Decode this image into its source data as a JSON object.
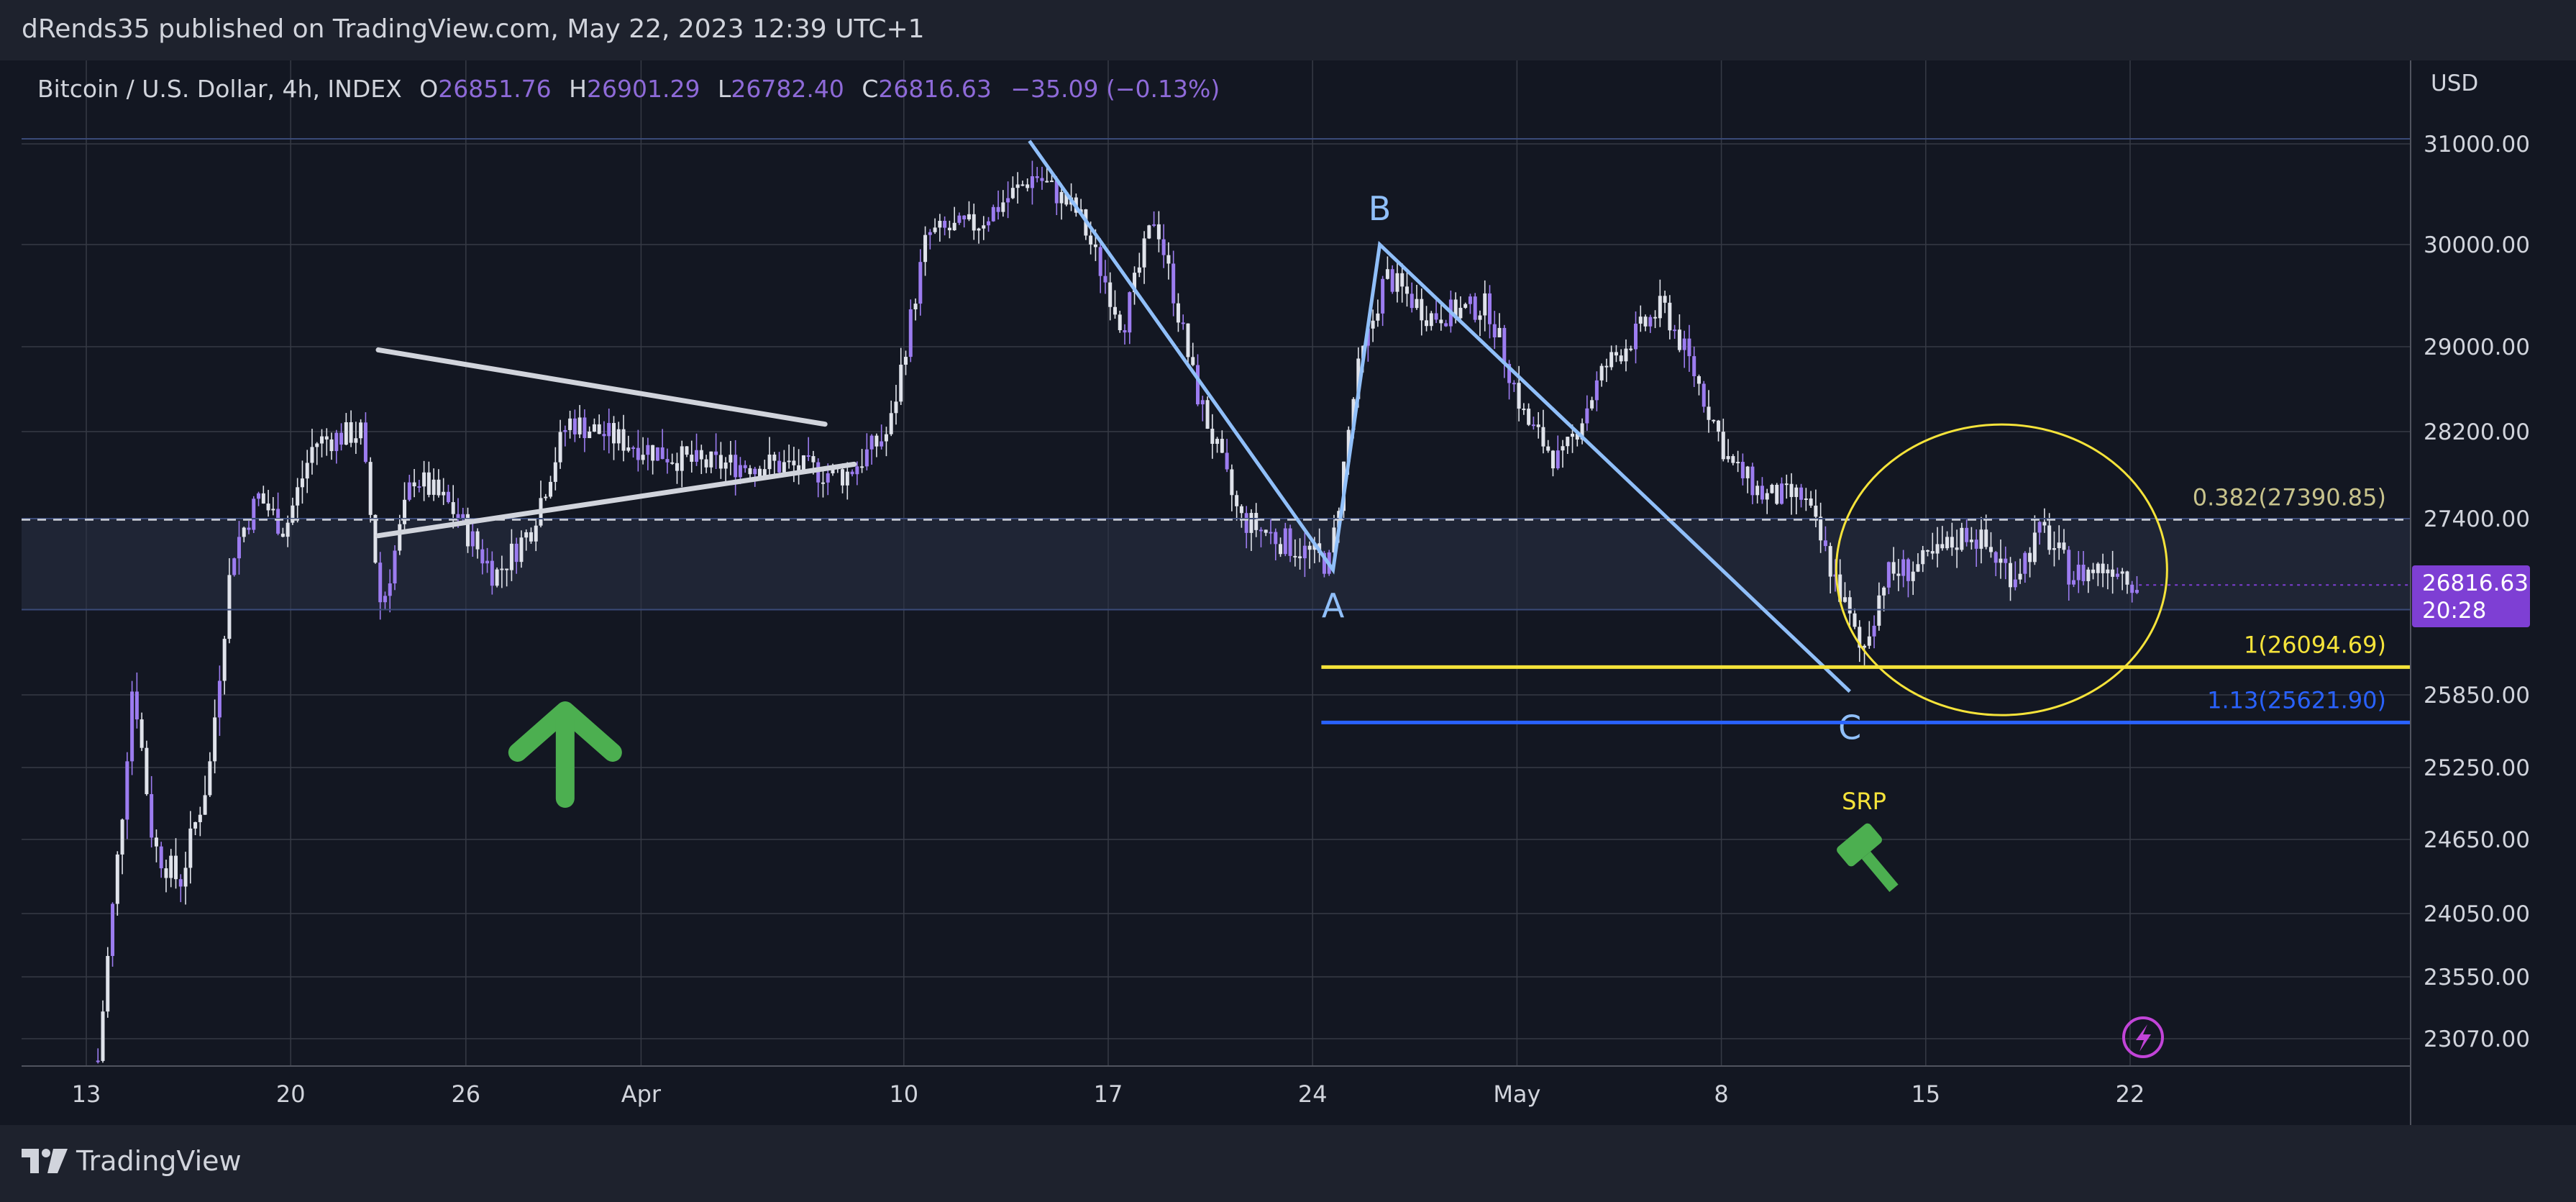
{
  "publisher_line": "dRends35 published on TradingView.com, May 22, 2023 12:39 UTC+1",
  "legend": {
    "symbol": "Bitcoin / U.S. Dollar, 4h, INDEX",
    "open_label": "O",
    "open": "26851.76",
    "high_label": "H",
    "high": "26901.29",
    "low_label": "L",
    "low": "26782.40",
    "close_label": "C",
    "close": "26816.63",
    "change": "−35.09 (−0.13%)"
  },
  "currency": "USD",
  "current_price": {
    "price": "26816.63",
    "countdown": "20:28"
  },
  "footer_brand": "TradingView",
  "colors": {
    "background": "#131722",
    "frame": "#1e222d",
    "grid": "#363a45",
    "candle": "#e0e3eb",
    "candle_accent": "#9c7cf0",
    "wave": "#90bff9",
    "triangle": "#d1d4dc",
    "fib_1": "#f5e33a",
    "fib_113": "#2962ff",
    "fib_0382": "#c8c38c",
    "ellipse": "#f5e33a",
    "arrow": "#4caf50",
    "srp_text": "#f5e33a",
    "price_tag": "#7e3fd4"
  },
  "icons": [
    "up-arrow-icon",
    "gavel-icon",
    "lightning-icon",
    "tradingview-logo-icon"
  ],
  "chart_data": {
    "type": "candlestick",
    "timeframe": "4h",
    "x_ticks": [
      {
        "label": "13",
        "day": 0
      },
      {
        "label": "20",
        "day": 7
      },
      {
        "label": "26",
        "day": 13
      },
      {
        "label": "Apr",
        "day": 19
      },
      {
        "label": "10",
        "day": 28
      },
      {
        "label": "17",
        "day": 35
      },
      {
        "label": "24",
        "day": 42
      },
      {
        "label": "May",
        "day": 49
      },
      {
        "label": "8",
        "day": 56
      },
      {
        "label": "15",
        "day": 63
      },
      {
        "label": "22",
        "day": 70
      }
    ],
    "y_ticks": [
      "31000.00",
      "30000.00",
      "29000.00",
      "28200.00",
      "27400.00",
      "25850.00",
      "25250.00",
      "24650.00",
      "24050.00",
      "23550.00",
      "23070.00"
    ],
    "price_path": [
      {
        "day": 0.4,
        "price": 22900
      },
      {
        "day": 1.2,
        "price": 24800
      },
      {
        "day": 1.6,
        "price": 26000
      },
      {
        "day": 2.3,
        "price": 24600
      },
      {
        "day": 3.2,
        "price": 24300
      },
      {
        "day": 4.2,
        "price": 25200
      },
      {
        "day": 5.0,
        "price": 27100
      },
      {
        "day": 5.9,
        "price": 27600
      },
      {
        "day": 6.8,
        "price": 27300
      },
      {
        "day": 7.8,
        "price": 28100
      },
      {
        "day": 9.4,
        "price": 28200
      },
      {
        "day": 10.1,
        "price": 26600
      },
      {
        "day": 11.2,
        "price": 27800
      },
      {
        "day": 12.5,
        "price": 27500
      },
      {
        "day": 14.0,
        "price": 26900
      },
      {
        "day": 15.2,
        "price": 27300
      },
      {
        "day": 16.5,
        "price": 28300
      },
      {
        "day": 18.5,
        "price": 28100
      },
      {
        "day": 21.0,
        "price": 27900
      },
      {
        "day": 23.5,
        "price": 27900
      },
      {
        "day": 26.0,
        "price": 27800
      },
      {
        "day": 27.5,
        "price": 28200
      },
      {
        "day": 28.8,
        "price": 30100
      },
      {
        "day": 30.5,
        "price": 30200
      },
      {
        "day": 32.5,
        "price": 30700
      },
      {
        "day": 34.0,
        "price": 30300
      },
      {
        "day": 35.5,
        "price": 29200
      },
      {
        "day": 36.6,
        "price": 30300
      },
      {
        "day": 38.0,
        "price": 28600
      },
      {
        "day": 39.5,
        "price": 27400
      },
      {
        "day": 41.0,
        "price": 27200
      },
      {
        "day": 42.6,
        "price": 27000
      },
      {
        "day": 43.5,
        "price": 28700
      },
      {
        "day": 44.5,
        "price": 29700
      },
      {
        "day": 46.0,
        "price": 29300
      },
      {
        "day": 48.0,
        "price": 29400
      },
      {
        "day": 49.3,
        "price": 28300
      },
      {
        "day": 50.5,
        "price": 27900
      },
      {
        "day": 52.0,
        "price": 28800
      },
      {
        "day": 54.0,
        "price": 29400
      },
      {
        "day": 55.0,
        "price": 28800
      },
      {
        "day": 56.3,
        "price": 27900
      },
      {
        "day": 57.5,
        "price": 27600
      },
      {
        "day": 58.8,
        "price": 27600
      },
      {
        "day": 60.0,
        "price": 26800
      },
      {
        "day": 60.8,
        "price": 26200
      },
      {
        "day": 61.6,
        "price": 26900
      },
      {
        "day": 63.0,
        "price": 27000
      },
      {
        "day": 64.5,
        "price": 27300
      },
      {
        "day": 66.0,
        "price": 26900
      },
      {
        "day": 67.0,
        "price": 27300
      },
      {
        "day": 68.0,
        "price": 26900
      },
      {
        "day": 69.5,
        "price": 27000
      },
      {
        "day": 70.3,
        "price": 26820
      }
    ],
    "wave_points": [
      {
        "label": "",
        "day": 32.3,
        "price": 31030
      },
      {
        "label": "A",
        "day": 42.7,
        "price": 26950
      },
      {
        "label": "B",
        "day": 44.3,
        "price": 30000
      },
      {
        "label": "C",
        "day": 60.4,
        "price": 25880
      }
    ],
    "triangle_lines": [
      {
        "from": {
          "day": 10.0,
          "price": 28970
        },
        "to": {
          "day": 25.3,
          "price": 28270
        }
      },
      {
        "from": {
          "day": 10.0,
          "price": 27250
        },
        "to": {
          "day": 26.3,
          "price": 27900
        }
      }
    ],
    "fib_levels": [
      {
        "label": "0.382(27390.85)",
        "price": 27390.85,
        "style": "dashed"
      },
      {
        "label": "1(26094.69)",
        "price": 26094.69
      },
      {
        "label": "1.13(25621.90)",
        "price": 25621.9
      }
    ],
    "range_band": {
      "from": 26600,
      "to": 27400
    },
    "annotations": {
      "srp_label": "SRP"
    }
  }
}
